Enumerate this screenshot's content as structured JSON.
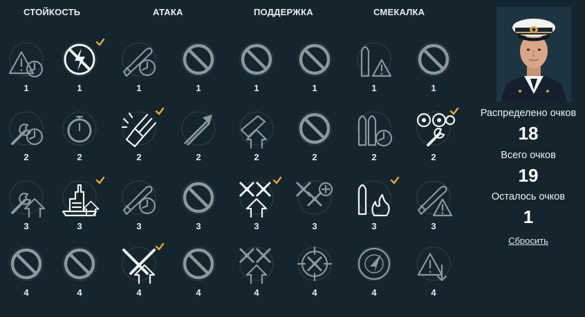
{
  "columns": [
    "СТОЙКОСТЬ",
    "АТАКА",
    "ПОДДЕРЖКА",
    "СМЕКАЛКА"
  ],
  "rows": [
    {
      "tier": "1",
      "skills": [
        {
          "icon": "warning-timer-icon",
          "learned": false,
          "checked": false
        },
        {
          "icon": "no-lightning-icon",
          "learned": true,
          "checked": true
        },
        {
          "icon": "torpedo-timer-icon",
          "learned": false,
          "checked": false
        },
        {
          "icon": "locked-slot-icon",
          "learned": false,
          "checked": false
        },
        {
          "icon": "locked-slot-icon",
          "learned": false,
          "checked": false
        },
        {
          "icon": "locked-slot-icon",
          "learned": false,
          "checked": false
        },
        {
          "icon": "shell-warning-icon",
          "learned": false,
          "checked": false
        },
        {
          "icon": "locked-slot-icon",
          "learned": false,
          "checked": false
        }
      ]
    },
    {
      "tier": "2",
      "skills": [
        {
          "icon": "wrench-timer-icon",
          "learned": false,
          "checked": false
        },
        {
          "icon": "stopwatch-icon",
          "learned": false,
          "checked": false
        },
        {
          "icon": "gun-burst-icon",
          "learned": true,
          "checked": true
        },
        {
          "icon": "torpedo-arrow-icon",
          "learned": false,
          "checked": false
        },
        {
          "icon": "aa-upgrade-icon",
          "learned": false,
          "checked": false
        },
        {
          "icon": "locked-slot-icon",
          "learned": false,
          "checked": false
        },
        {
          "icon": "shells-timer-icon",
          "learned": false,
          "checked": false
        },
        {
          "icon": "gears-wrench-icon",
          "learned": true,
          "checked": true
        }
      ]
    },
    {
      "tier": "3",
      "skills": [
        {
          "icon": "wrench-upgrade-icon",
          "learned": false,
          "checked": false
        },
        {
          "icon": "ship-upgrade-icon",
          "learned": true,
          "checked": true
        },
        {
          "icon": "torpedo-timer-icon",
          "learned": false,
          "checked": false
        },
        {
          "icon": "locked-slot-icon",
          "learned": false,
          "checked": false
        },
        {
          "icon": "aircraft-upgrade-icon",
          "learned": true,
          "checked": true
        },
        {
          "icon": "aircraft-plus-icon",
          "learned": false,
          "checked": false
        },
        {
          "icon": "shell-fire-icon",
          "learned": true,
          "checked": true
        },
        {
          "icon": "torpedo-warning-icon",
          "learned": false,
          "checked": false
        }
      ]
    },
    {
      "tier": "4",
      "skills": [
        {
          "icon": "locked-slot-icon",
          "learned": false,
          "checked": false
        },
        {
          "icon": "locked-slot-icon",
          "learned": false,
          "checked": false
        },
        {
          "icon": "crossed-arrows-upgrade-icon",
          "learned": true,
          "checked": true
        },
        {
          "icon": "locked-slot-icon",
          "learned": false,
          "checked": false
        },
        {
          "icon": "aircraft-upgrade-icon",
          "learned": false,
          "checked": false
        },
        {
          "icon": "crosshair-plane-icon",
          "learned": false,
          "checked": false
        },
        {
          "icon": "radar-icon",
          "learned": false,
          "checked": false
        },
        {
          "icon": "warning-down-icon",
          "learned": false,
          "checked": false
        }
      ]
    }
  ],
  "commander": {
    "portrait": "commander-portrait"
  },
  "stats": {
    "distributed_label": "Распределено очков",
    "distributed_value": "18",
    "total_label": "Всего очков",
    "total_value": "19",
    "remaining_label": "Осталось очков",
    "remaining_value": "1"
  },
  "reset_label": "Сбросить",
  "colors": {
    "background": "#14252d",
    "check": "#e8a83a",
    "learned_icon": "#f2f4f5",
    "unlearned_icon": "#8d989d"
  }
}
